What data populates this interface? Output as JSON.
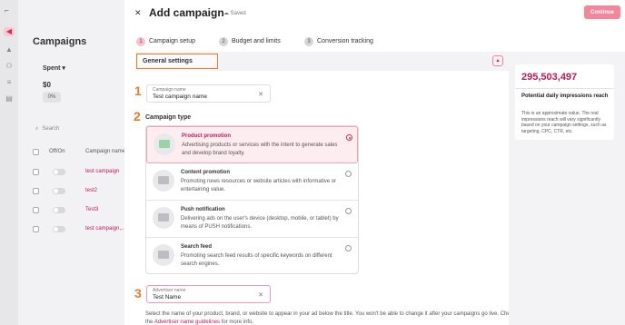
{
  "background": {
    "page_title": "Campaigns",
    "spent_label": "Spent",
    "spent_amount": "$0",
    "spent_pct": "0%",
    "search_label": "Search",
    "columns": [
      "Off/On",
      "Campaign name"
    ],
    "rows": [
      "test campaign",
      "test2",
      "Test3",
      "test campaign,..."
    ]
  },
  "modal": {
    "title": "Add campaign",
    "saved_label": "Saved",
    "continue_label": "Continue",
    "steps": [
      {
        "num": "1",
        "label": "Campaign setup"
      },
      {
        "num": "2",
        "label": "Budget and limits"
      },
      {
        "num": "3",
        "label": "Conversion tracking"
      }
    ],
    "section_title": "General settings",
    "markers": [
      "1",
      "2",
      "3"
    ],
    "campaign_name": {
      "label": "Campaign name",
      "value": "Test campaign name"
    },
    "campaign_type_heading": "Campaign type",
    "campaign_types": [
      {
        "title": "Product promotion",
        "desc": "Advertising products or services with the intent to generate sales and develop brand loyalty.",
        "selected": true
      },
      {
        "title": "Content promotion",
        "desc": "Promoting news resources or website articles with informative or entertaining value.",
        "selected": false
      },
      {
        "title": "Push notification",
        "desc": "Delivering ads on the user's device (desktop, mobile, or tablet) by means of PUSH notifications.",
        "selected": false
      },
      {
        "title": "Search feed",
        "desc": "Promoting search feed results of specific keywords on different search engines.",
        "selected": false
      }
    ],
    "advertiser_name": {
      "label": "Advertiser name",
      "value": "Test Name"
    },
    "help_text_before": "Select the name of your product, brand, or website to appear in your ad below the title. You won't be able to change it after your campaigns go live. Check out the ",
    "help_link": "Advertiser name guidelines",
    "help_text_after": " for more info."
  },
  "impressions": {
    "number": "295,503,497",
    "title": "Potential daily impressions reach",
    "desc": "This is an approximate value. The real impressions reach will vary significantly based on your campaign settings, such as targeting, CPC, CTR, etc."
  },
  "colors": {
    "accent": "#e4244a",
    "brand": "#c2185b",
    "highlight": "#ef7a2a"
  }
}
